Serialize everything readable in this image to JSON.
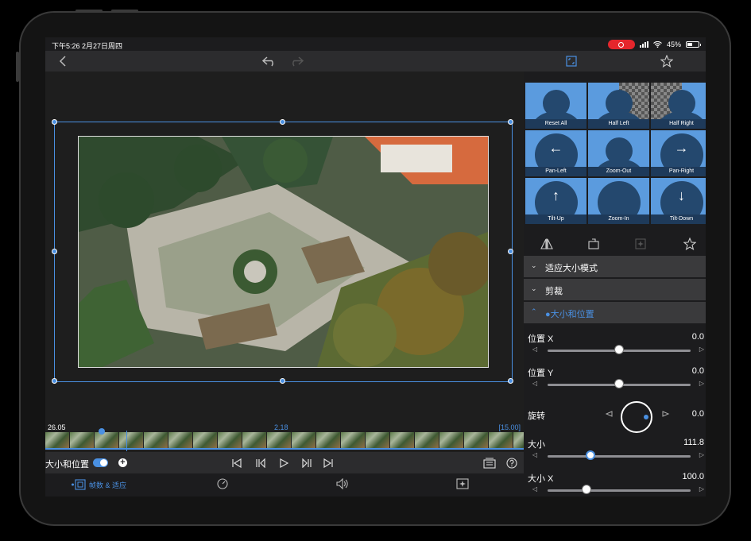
{
  "status_bar": {
    "time": "下午5:26  2月27日周四",
    "battery": "45%"
  },
  "preview": {
    "timecode_left": "26.05",
    "timecode_center": "2.18",
    "timecode_right": "[15.00]"
  },
  "controls": {
    "label": "大小和位置"
  },
  "bottom_bar": {
    "frame_fit_label": "帧数 & 适应"
  },
  "presets": {
    "tiles": [
      {
        "label": "Reset All"
      },
      {
        "label": "Half Left"
      },
      {
        "label": "Half Right"
      },
      {
        "label": "Pan-Left"
      },
      {
        "label": "Zoom-Out"
      },
      {
        "label": "Pan-Right"
      },
      {
        "label": "Tilt-Up"
      },
      {
        "label": "Zoom-In"
      },
      {
        "label": "Tilt-Down"
      }
    ]
  },
  "sections": {
    "fit_mode": "适应大小模式",
    "crop": "剪裁",
    "size_position": "●大小和位置"
  },
  "params": {
    "position_x": {
      "name": "位置 X",
      "value": "0.0",
      "level": 0.5
    },
    "position_y": {
      "name": "位置 Y",
      "value": "0.0",
      "level": 0.5
    },
    "rotation": {
      "name": "旋转",
      "value": "0.0"
    },
    "size": {
      "name": "大小",
      "value": "111.8",
      "level": 0.3
    },
    "size_x": {
      "name": "大小 X",
      "value": "100.0",
      "level": 0.27
    }
  }
}
